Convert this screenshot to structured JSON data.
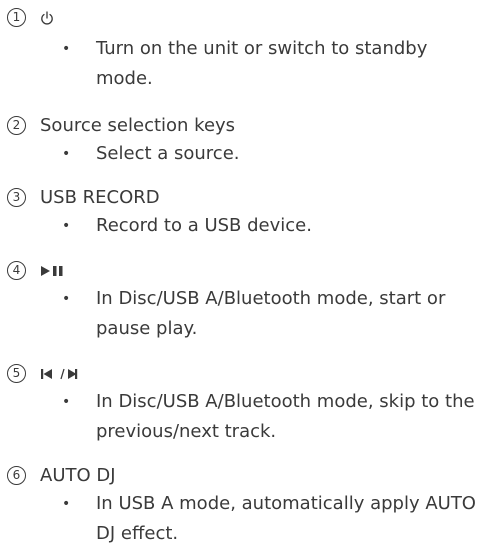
{
  "items": [
    {
      "number": "1",
      "heading": "",
      "icon": "power-icon",
      "bullet": "•",
      "desc": "Turn on the unit or switch to standby mode."
    },
    {
      "number": "2",
      "heading": "Source selection keys",
      "bullet": "•",
      "desc": "Select a source."
    },
    {
      "number": "3",
      "heading": "USB RECORD",
      "bullet": "•",
      "desc": "Record to a USB device."
    },
    {
      "number": "4",
      "heading": "",
      "icon": "play-pause-icon",
      "bullet": "•",
      "desc": "In Disc/USB A/Bluetooth mode, start or pause play."
    },
    {
      "number": "5",
      "heading": "",
      "icon": "skip-prev-next-icon",
      "bullet": "•",
      "desc": "In Disc/USB A/Bluetooth mode, skip to the previous/next track."
    },
    {
      "number": "6",
      "heading": "AUTO DJ",
      "bullet": "•",
      "desc": "In USB A mode, automatically apply AUTO DJ effect."
    }
  ]
}
